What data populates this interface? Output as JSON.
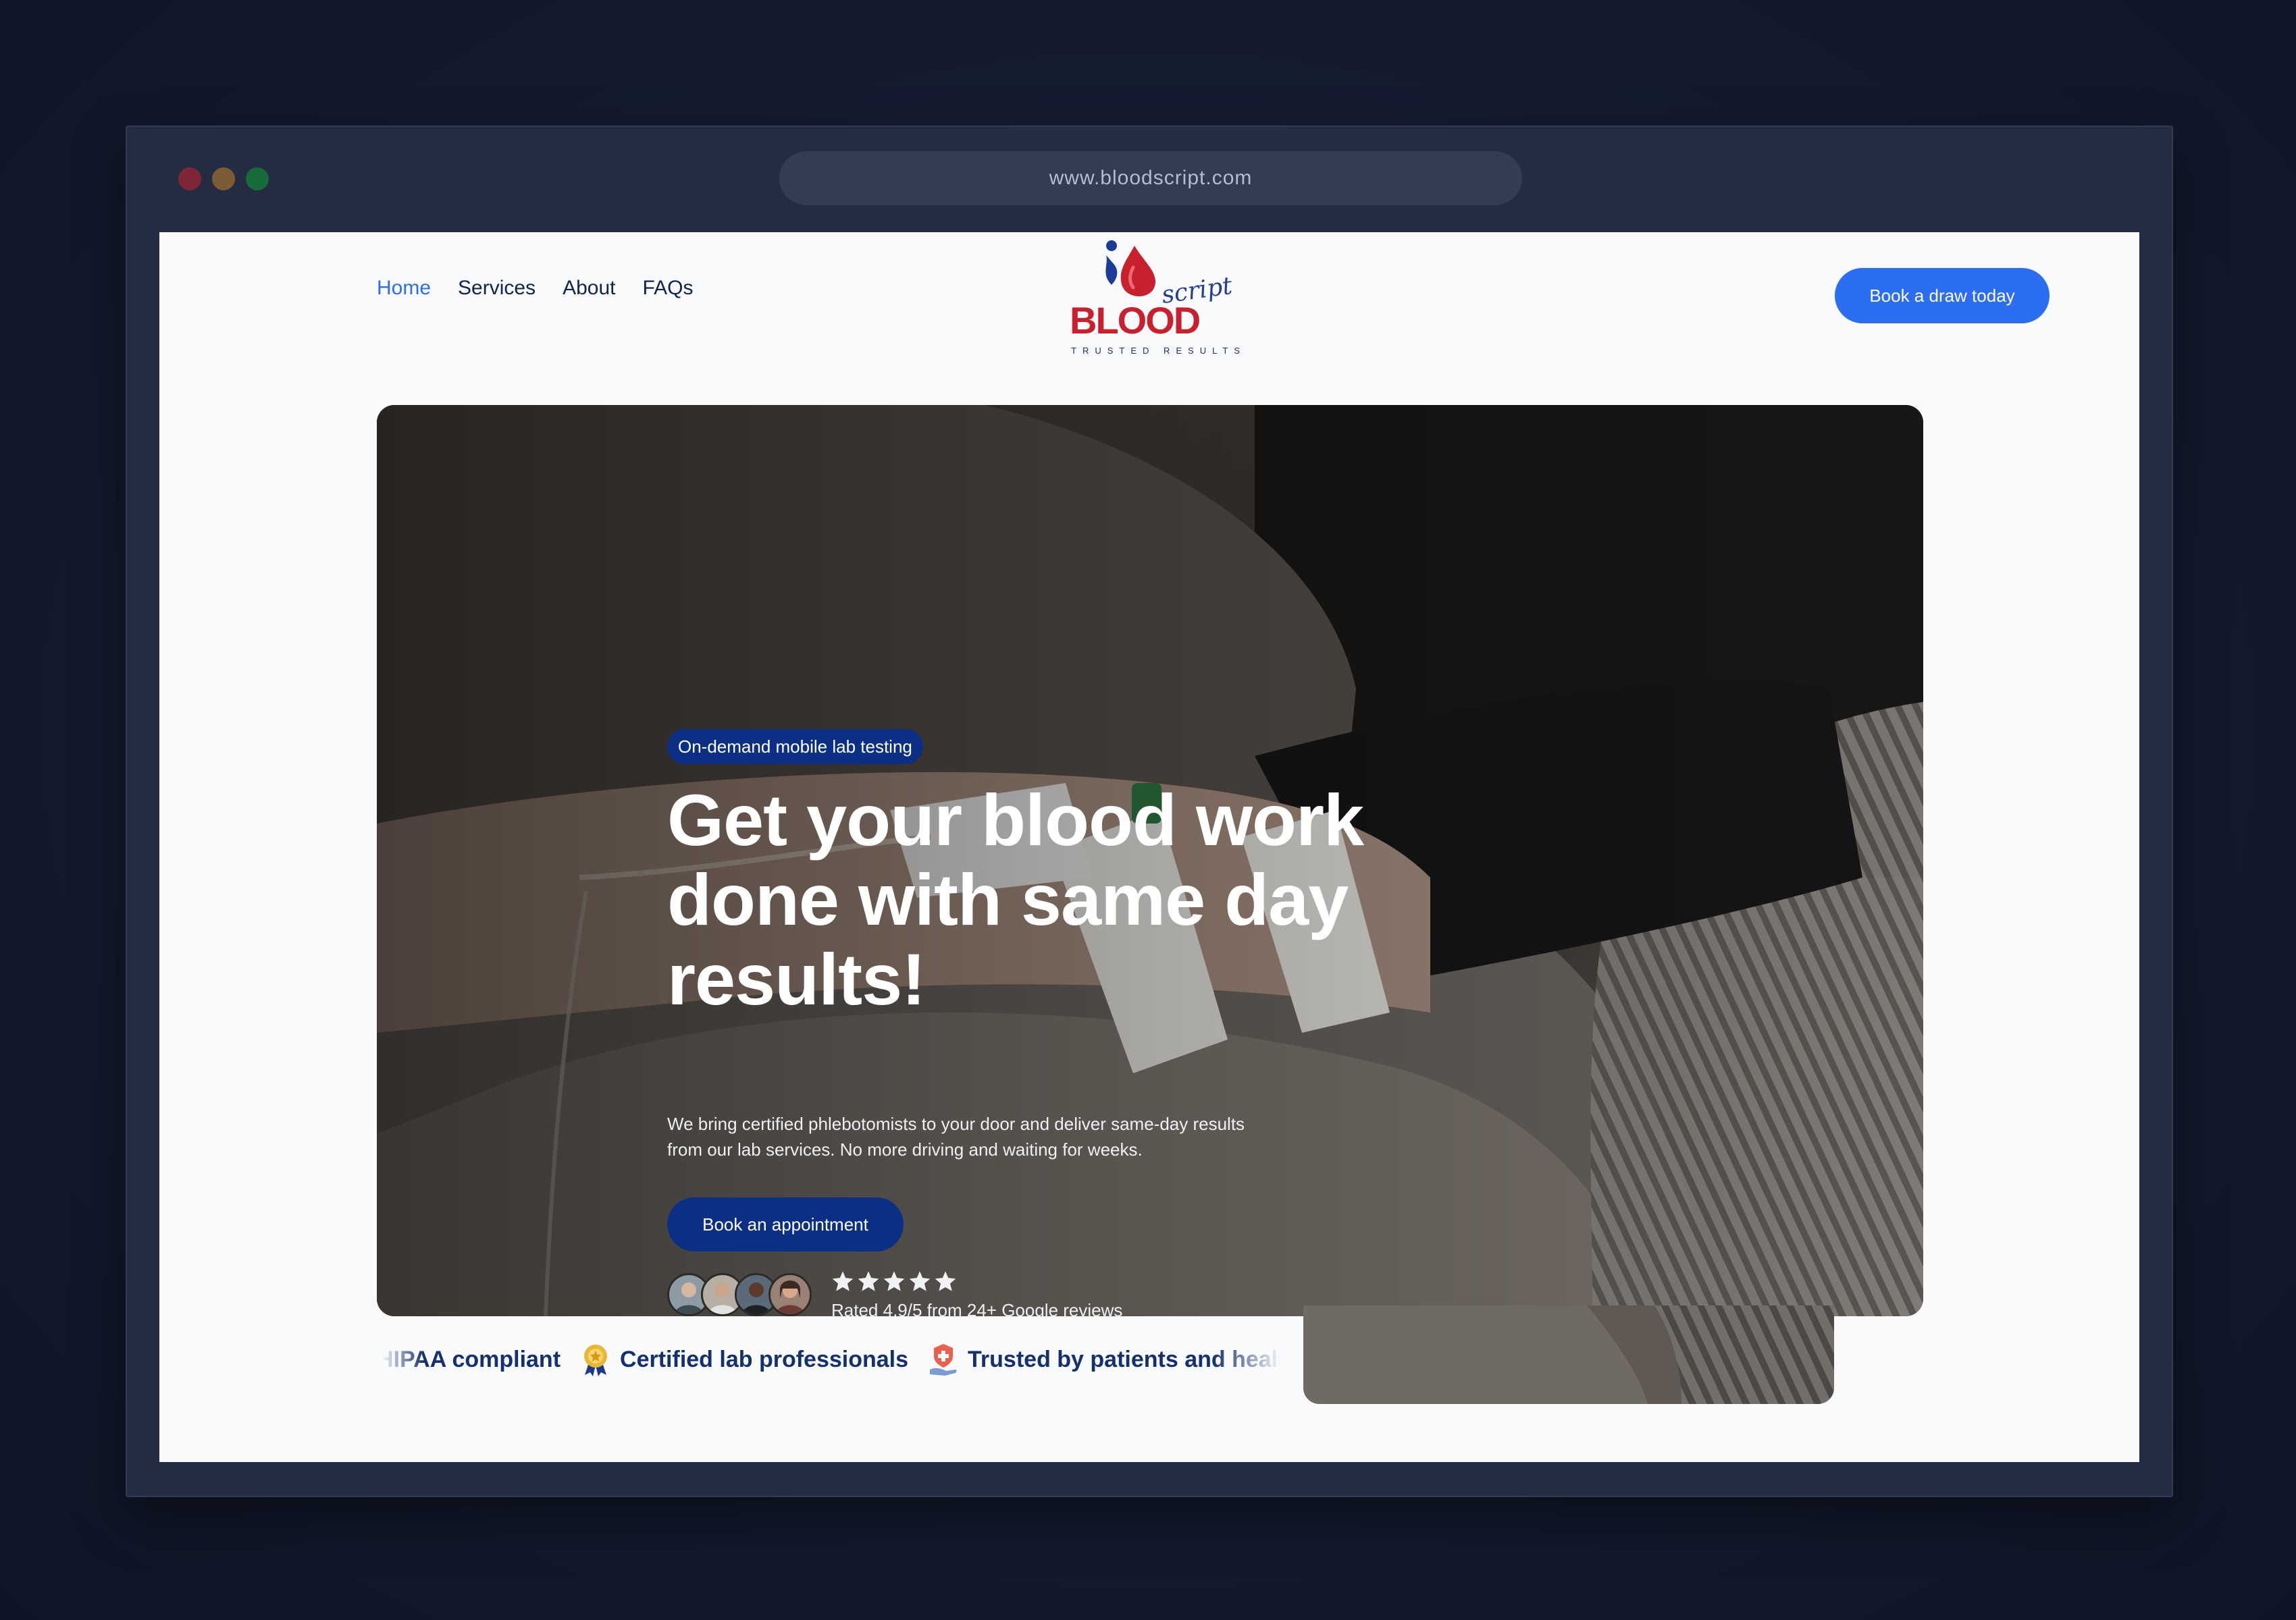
{
  "browser": {
    "url": "www.bloodscript.com"
  },
  "nav": {
    "links": [
      "Home",
      "Services",
      "About",
      "FAQs"
    ],
    "active": "Home"
  },
  "logo": {
    "word": "BLOOD",
    "script": "script",
    "tagline": "TRUSTED RESULTS"
  },
  "header": {
    "cta_label": "Book a draw today"
  },
  "hero": {
    "badge": "On-demand mobile lab testing",
    "headline": "Get your blood work done with same day results!",
    "lead": "We bring certified phlebotomists to your door and deliver same-day results from our lab services. No more driving and waiting for weeks.",
    "book_label": "Book an appointment",
    "stars": 5,
    "rating_text": "Rated 4.9/5 from 24+ Google reviews",
    "avatar_count": 4
  },
  "trust_strip": {
    "items": [
      {
        "icon": "compliance-icon",
        "label": "HIPAA compliant"
      },
      {
        "icon": "medal-icon",
        "label": "Certified lab professionals"
      },
      {
        "icon": "shield-hand-icon",
        "label": "Trusted by patients and healthcare providers"
      }
    ]
  },
  "colors": {
    "brand_blue": "#2b6ef2",
    "navy": "#0c2f86",
    "text_navy": "#14306f",
    "logo_red": "#c9202e",
    "link_active": "#2b6ee6",
    "page_bg": "#f9fafc"
  }
}
